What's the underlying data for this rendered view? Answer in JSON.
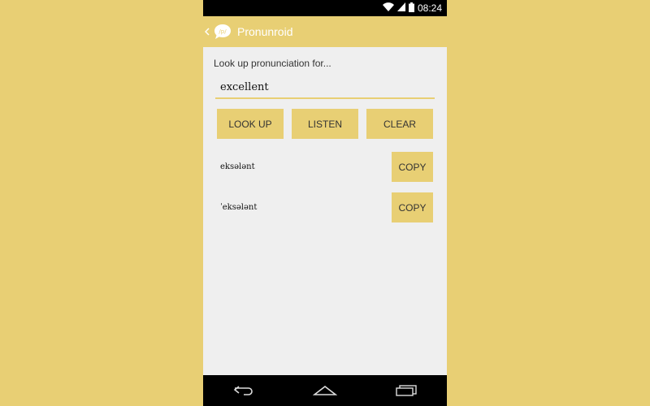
{
  "status_bar": {
    "time": "08:24",
    "icons": [
      "wifi-icon",
      "signal-icon",
      "battery-icon"
    ]
  },
  "action_bar": {
    "title": "Pronunroid",
    "icon": "speech-bubble-ipa-icon",
    "icon_text": "/p/"
  },
  "main": {
    "prompt": "Look up pronunciation for...",
    "input_value": "excellent",
    "buttons": {
      "look_up": "LOOK UP",
      "listen": "LISTEN",
      "clear": "CLEAR"
    },
    "results": [
      {
        "ipa": "eksələnt",
        "copy_label": "COPY"
      },
      {
        "ipa": "ˈeksələnt",
        "copy_label": "COPY"
      }
    ]
  },
  "nav_bar": {
    "icons": [
      "back-arrow-icon",
      "home-icon",
      "recents-icon"
    ]
  },
  "colors": {
    "accent": "#E8CF74",
    "background": "#EFEFEF",
    "bars": "#000000"
  }
}
